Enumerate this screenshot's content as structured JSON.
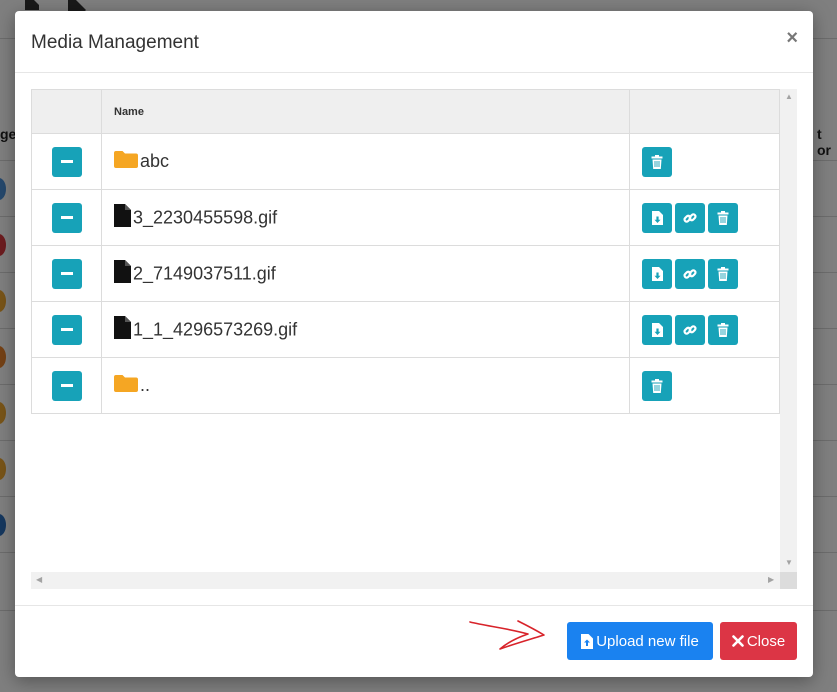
{
  "modal": {
    "title": "Media Management",
    "close_glyph": "×"
  },
  "table": {
    "columns": [
      "",
      "Name",
      ""
    ],
    "rows": [
      {
        "name": "abc",
        "type": "folder",
        "actions": [
          "trash-icon"
        ]
      },
      {
        "name": "3_2230455598.gif",
        "type": "file",
        "actions": [
          "file-download-icon",
          "link-icon",
          "trash-icon"
        ]
      },
      {
        "name": "2_7149037511.gif",
        "type": "file",
        "actions": [
          "file-download-icon",
          "link-icon",
          "trash-icon"
        ]
      },
      {
        "name": "1_1_4296573269.gif",
        "type": "file",
        "actions": [
          "file-download-icon",
          "link-icon",
          "trash-icon"
        ]
      },
      {
        "name": "..",
        "type": "folder",
        "actions": [
          "trash-icon"
        ]
      }
    ]
  },
  "footer": {
    "upload_label": "Upload new file",
    "close_label": "Close"
  },
  "background": {
    "left_fragment": "ge",
    "right_fragment": "t or"
  },
  "colors": {
    "teal": "#17a2b8",
    "primary": "#1a82f0",
    "danger": "#dc3545",
    "folder": "#f5a623",
    "annotation_arrow": "#d8232a"
  }
}
